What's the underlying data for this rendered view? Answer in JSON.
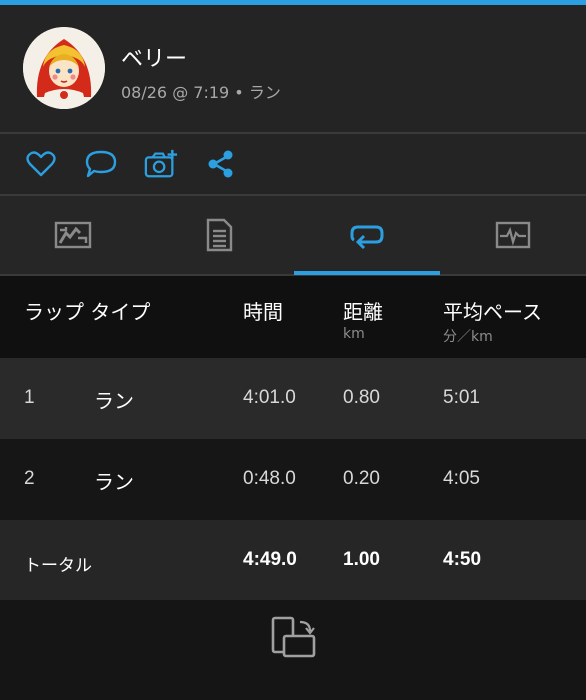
{
  "header": {
    "username": "ベリー",
    "meta": "08/26 @ 7:19 • ラン"
  },
  "actions": [
    {
      "icon": "heart-icon"
    },
    {
      "icon": "comment-icon"
    },
    {
      "icon": "add-photo-icon"
    },
    {
      "icon": "share-icon"
    }
  ],
  "tabs": [
    {
      "icon": "map-chart-icon",
      "active": false
    },
    {
      "icon": "details-document-icon",
      "active": false
    },
    {
      "icon": "laps-loop-icon",
      "active": true
    },
    {
      "icon": "activity-graph-icon",
      "active": false
    }
  ],
  "colors": {
    "accent": "#2b9fe0",
    "background": "#101010",
    "row_light": "#2a2a2a",
    "row_dark": "#161616"
  },
  "laps_table": {
    "headers": {
      "lap_type": "ラップ タイプ",
      "time": "時間",
      "distance": "距離",
      "distance_unit": "km",
      "avg_pace": "平均ペース",
      "avg_pace_unit": "分／km"
    },
    "rows": [
      {
        "lap": "1",
        "type": "ラン",
        "time": "4:01.0",
        "distance": "0.80",
        "pace": "5:01"
      },
      {
        "lap": "2",
        "type": "ラン",
        "time": "0:48.0",
        "distance": "0.20",
        "pace": "4:05"
      }
    ],
    "total": {
      "label": "トータル",
      "time": "4:49.0",
      "distance": "1.00",
      "pace": "4:50"
    }
  },
  "footer": {
    "icon": "rotate-screen-icon"
  }
}
